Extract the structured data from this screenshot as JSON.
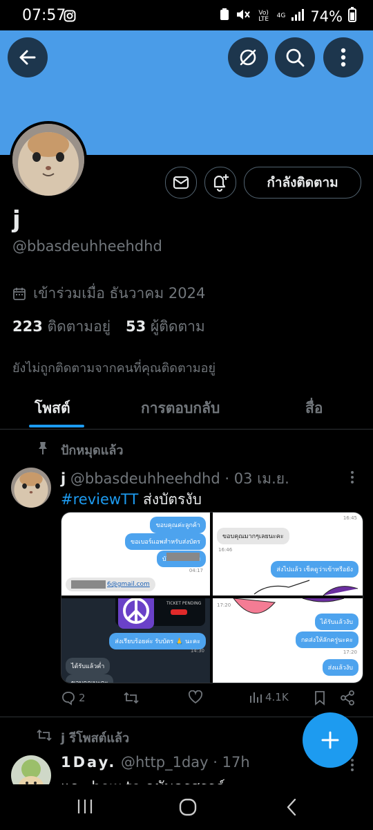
{
  "status_bar": {
    "time": "07:57",
    "volte": "Vo) LTE",
    "net": "4G",
    "battery": "74%"
  },
  "profile": {
    "name": "j",
    "handle": "@bbasdeuhheehdhd",
    "joined": "เข้าร่วมเมื่อ ธันวาคม 2024",
    "following_count": "223",
    "following_label": "ติดตามอยู่",
    "followers_count": "53",
    "followers_label": "ผู้ติดตาม",
    "not_followed_note": "ยังไม่ถูกติดตามจากคนที่คุณติดตามอยู่",
    "follow_button": "กำลังติดตาม"
  },
  "tabs": [
    {
      "label": "โพสต์",
      "active": true
    },
    {
      "label": "การตอบกลับ",
      "active": false
    },
    {
      "label": "สื่อ",
      "active": false
    }
  ],
  "pinned_label": "ปักหมุดแล้ว",
  "tweet1": {
    "name": "j",
    "handle": "@bbasdeuhheehdhd",
    "date": "· 03 เม.ย.",
    "hashtag": "#reviewTT",
    "text": " ส่งบัตรงับ",
    "media": {
      "tl": {
        "b1": "ขอบคุณค่ะลูกค้า",
        "b2": "ขอเบอร์แอพสำหรับส่งบัตร",
        "b3": "บัตรวันอาทิตย",
        "ts": "04:17",
        "email": "6@gmail.com"
      },
      "tr": {
        "ts1": "16:45",
        "b1": "ขอบคุณมากๆเลยนะคะ",
        "ts2": "16:46",
        "b2": "ส่งไปแล้ว เช็คดูว่าเข้าหรือยัง"
      },
      "bl": {
        "ticket": "TICKET PENDING",
        "b1": "ส่งเรียบร้อยค่ะ รับบัตร 🙏 นะคะ",
        "ts": "14:30",
        "b2": "ได้รับแล้วค่ำ",
        "b3": "ขอบคุณนะคะ"
      },
      "br": {
        "ts1": "17:20",
        "b1": "ได้รับแล้วงับ",
        "b2": "กดส่งให้ลักครู่นะคะ",
        "ts2": "17:20",
        "b3": "ส่งแล้วงับ"
      }
    },
    "replies": "2",
    "views": "4.1K"
  },
  "repost_label": "j รีโพสต์แล้ว",
  "tweet2": {
    "name": "1Day.",
    "handle": "@http_1day",
    "time": "· 17h",
    "text": "และ how to ฉบับครสรรค์"
  },
  "colors": {
    "accent": "#1d9bf0",
    "banner": "#4a9ce8",
    "muted": "#71767b"
  }
}
